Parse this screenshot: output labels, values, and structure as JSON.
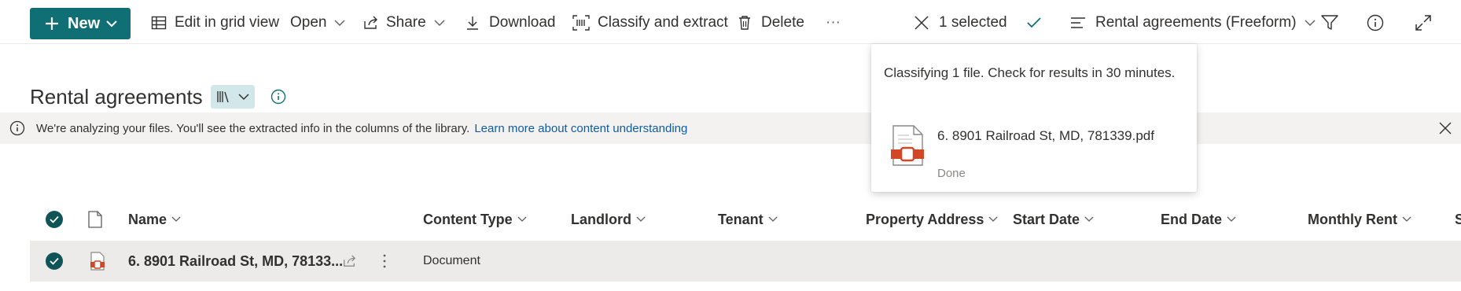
{
  "toolbar": {
    "new_label": "New",
    "edit_grid_label": "Edit in grid view",
    "open_label": "Open",
    "share_label": "Share",
    "download_label": "Download",
    "classify_label": "Classify and extract",
    "delete_label": "Delete",
    "more_label": "···",
    "selected_label": "1 selected",
    "view_label": "Rental agreements (Freeform)"
  },
  "library": {
    "title": "Rental agreements"
  },
  "banner": {
    "text": "We're analyzing your files. You'll see the extracted info in the columns of the library.",
    "link": "Learn more about content understanding"
  },
  "columns": {
    "name": "Name",
    "content_type": "Content Type",
    "landlord": "Landlord",
    "tenant": "Tenant",
    "property_address": "Property Address",
    "start_date": "Start Date",
    "end_date": "End Date",
    "monthly_rent": "Monthly Rent",
    "overflow": "S"
  },
  "rows": [
    {
      "name": "6. 8901 Railroad St, MD, 78133...",
      "content_type": "Document"
    }
  ],
  "popup": {
    "message": "Classifying 1 file. Check for results in 30 minutes.",
    "file_name": "6. 8901 Railroad St, MD, 781339.pdf",
    "status": "Done"
  },
  "colors": {
    "accent": "#0f6f74",
    "check": "#0f5558",
    "pdf_red": "#d24726",
    "link": "#0f5c9e"
  }
}
